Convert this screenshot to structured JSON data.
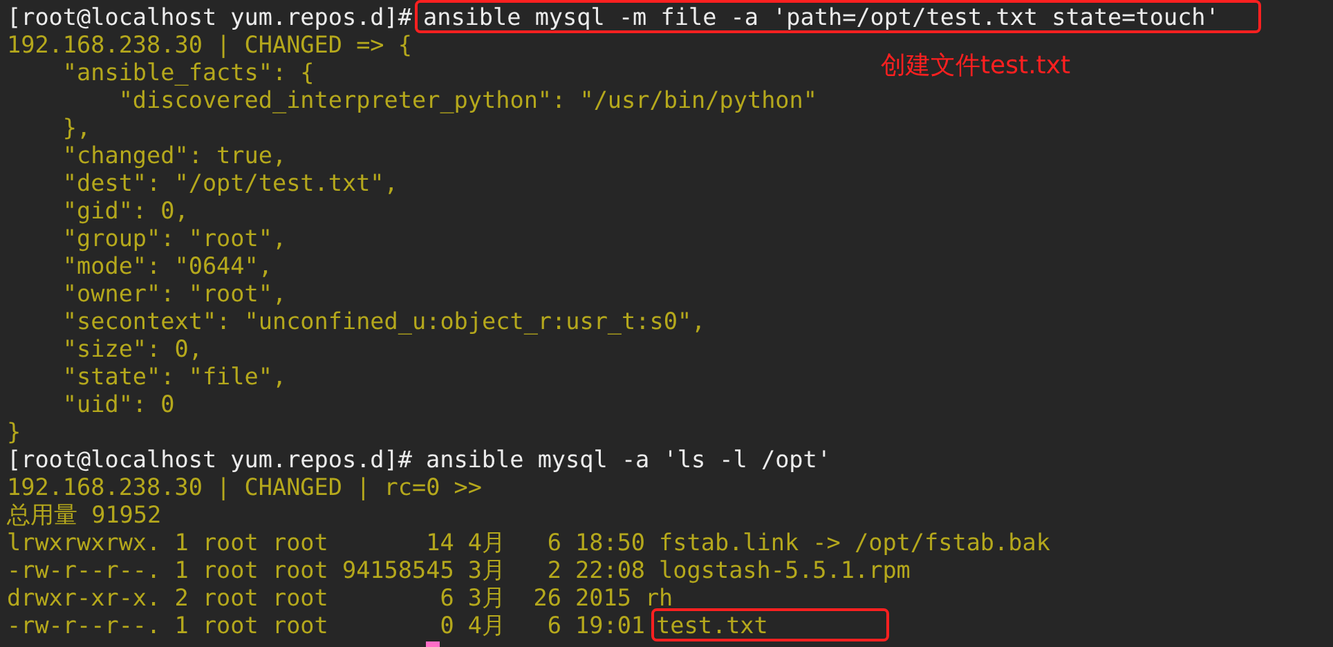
{
  "terminal": {
    "lines": [
      {
        "kind": "command",
        "prompt": "[root@localhost yum.repos.d]#",
        "command": "ansible mysql -m file -a 'path=/opt/test.txt state=touch'",
        "boxed": true
      },
      {
        "kind": "output",
        "text": "192.168.238.30 | CHANGED => {"
      },
      {
        "kind": "output",
        "text": "    \"ansible_facts\": {"
      },
      {
        "kind": "output",
        "text": "        \"discovered_interpreter_python\": \"/usr/bin/python\""
      },
      {
        "kind": "output",
        "text": "    },"
      },
      {
        "kind": "output",
        "text": "    \"changed\": true,"
      },
      {
        "kind": "output",
        "text": "    \"dest\": \"/opt/test.txt\","
      },
      {
        "kind": "output",
        "text": "    \"gid\": 0,"
      },
      {
        "kind": "output",
        "text": "    \"group\": \"root\","
      },
      {
        "kind": "output",
        "text": "    \"mode\": \"0644\","
      },
      {
        "kind": "output",
        "text": "    \"owner\": \"root\","
      },
      {
        "kind": "output",
        "text": "    \"secontext\": \"unconfined_u:object_r:usr_t:s0\","
      },
      {
        "kind": "output",
        "text": "    \"size\": 0,"
      },
      {
        "kind": "output",
        "text": "    \"state\": \"file\","
      },
      {
        "kind": "output",
        "text": "    \"uid\": 0"
      },
      {
        "kind": "output",
        "text": "}"
      },
      {
        "kind": "command",
        "prompt": "[root@localhost yum.repos.d]#",
        "command": "ansible mysql -a 'ls -l /opt'",
        "boxed": false
      },
      {
        "kind": "output",
        "text": "192.168.238.30 | CHANGED | rc=0 >>"
      },
      {
        "kind": "output",
        "text": "总用量 91952"
      },
      {
        "kind": "listing",
        "meta": "lrwxrwxrwx. 1 root root       14 4月   6 18:50",
        "name": "fstab.link -> /opt/fstab.bak",
        "boxed": false
      },
      {
        "kind": "listing",
        "meta": "-rw-r--r--. 1 root root 94158545 3月   2 22:08",
        "name": "logstash-5.5.1.rpm",
        "boxed": false
      },
      {
        "kind": "listing",
        "meta": "drwxr-xr-x. 2 root root        6 3月  26 2015",
        "name": "rh",
        "boxed": false
      },
      {
        "kind": "listing",
        "meta": "-rw-r--r--. 1 root root        0 4月   6 19:01",
        "name": "test.txt",
        "boxed": true
      },
      {
        "kind": "prompt",
        "cursor": true
      }
    ]
  },
  "annotation": "创建文件test.txt"
}
